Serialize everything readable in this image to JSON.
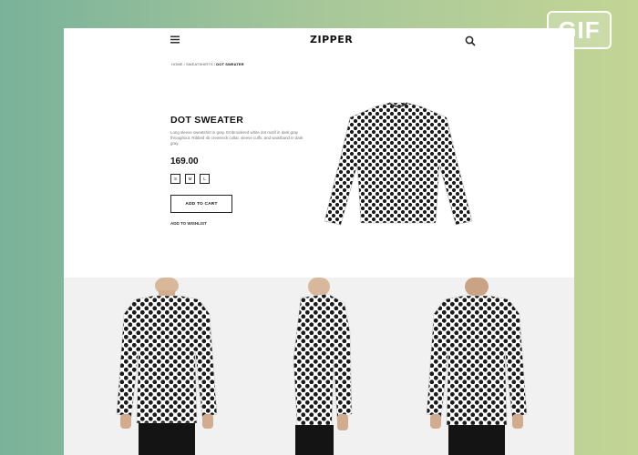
{
  "badge": {
    "label": "GIF"
  },
  "header": {
    "logo": "ZIPPER"
  },
  "breadcrumb": {
    "path": "HOME / SWEATSHIRTS / ",
    "current": "DOT SWEATER"
  },
  "product": {
    "title": "DOT SWEATER",
    "description": "Long sleeve sweatshirt in gray. Embroidered white dot motif in dark gray throughout. Ribbed rib crewneck collar, sleeve cuffs, and waistband in dark gray.",
    "price": "169.00",
    "sizes": [
      "S",
      "M",
      "L"
    ],
    "add_to_cart_label": "ADD TO CART",
    "wishlist_label": "ADD TO WISHLIST"
  },
  "colors": {
    "background_left": "#79b29a",
    "background_right": "#c3d595",
    "gallery_bg": "#f1f1f1",
    "text": "#111111"
  },
  "icons": [
    "menu-icon",
    "search-icon"
  ]
}
